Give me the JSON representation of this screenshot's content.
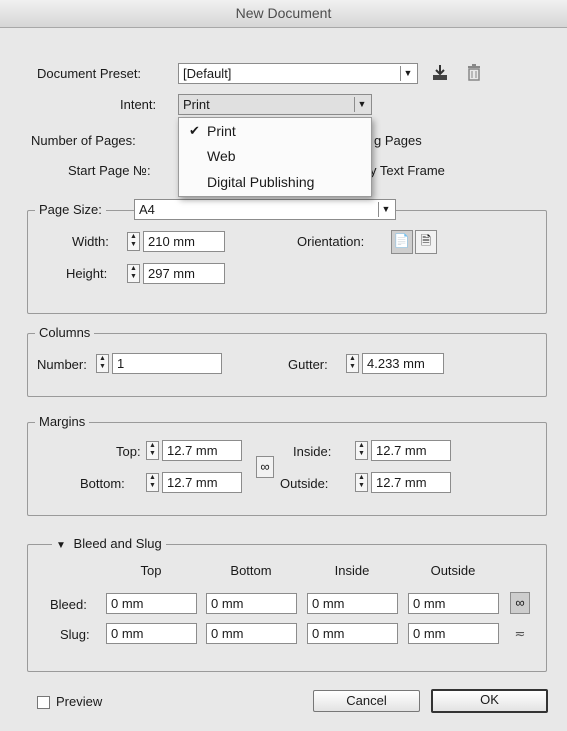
{
  "window": {
    "title": "New Document"
  },
  "preset": {
    "label": "Document Preset:",
    "value": "[Default]"
  },
  "intent": {
    "label": "Intent:",
    "value": "Print"
  },
  "pages": {
    "label": "Number of Pages:",
    "facing_partial": "g Pages"
  },
  "start_page": {
    "label": "Start Page №:",
    "text_frame_partial": "y Text Frame"
  },
  "intent_menu": {
    "items": [
      "Print",
      "Web",
      "Digital Publishing"
    ],
    "checked": "Print"
  },
  "page_size": {
    "label": "Page Size:",
    "value": "A4",
    "width_label": "Width:",
    "width": "210 mm",
    "height_label": "Height:",
    "height": "297 mm",
    "orientation_label": "Orientation:"
  },
  "columns": {
    "title": "Columns",
    "number_label": "Number:",
    "number": "1",
    "gutter_label": "Gutter:",
    "gutter": "4.233 mm"
  },
  "margins": {
    "title": "Margins",
    "top_label": "Top:",
    "top": "12.7 mm",
    "bottom_label": "Bottom:",
    "bottom": "12.7 mm",
    "inside_label": "Inside:",
    "inside": "12.7 mm",
    "outside_label": "Outside:",
    "outside": "12.7 mm"
  },
  "bleed_slug": {
    "title": "Bleed and Slug",
    "headers": [
      "Top",
      "Bottom",
      "Inside",
      "Outside"
    ],
    "bleed_label": "Bleed:",
    "bleed": [
      "0 mm",
      "0 mm",
      "0 mm",
      "0 mm"
    ],
    "slug_label": "Slug:",
    "slug": [
      "0 mm",
      "0 mm",
      "0 mm",
      "0 mm"
    ]
  },
  "footer": {
    "preview_label": "Preview",
    "cancel_label": "Cancel",
    "ok_label": "OK"
  },
  "icons": [
    "save-preset-icon",
    "delete-preset-icon",
    "portrait-orientation-icon",
    "landscape-orientation-icon",
    "link-icon",
    "unlink-icon",
    "disclosure-triangle-icon",
    "checkmark-icon"
  ]
}
